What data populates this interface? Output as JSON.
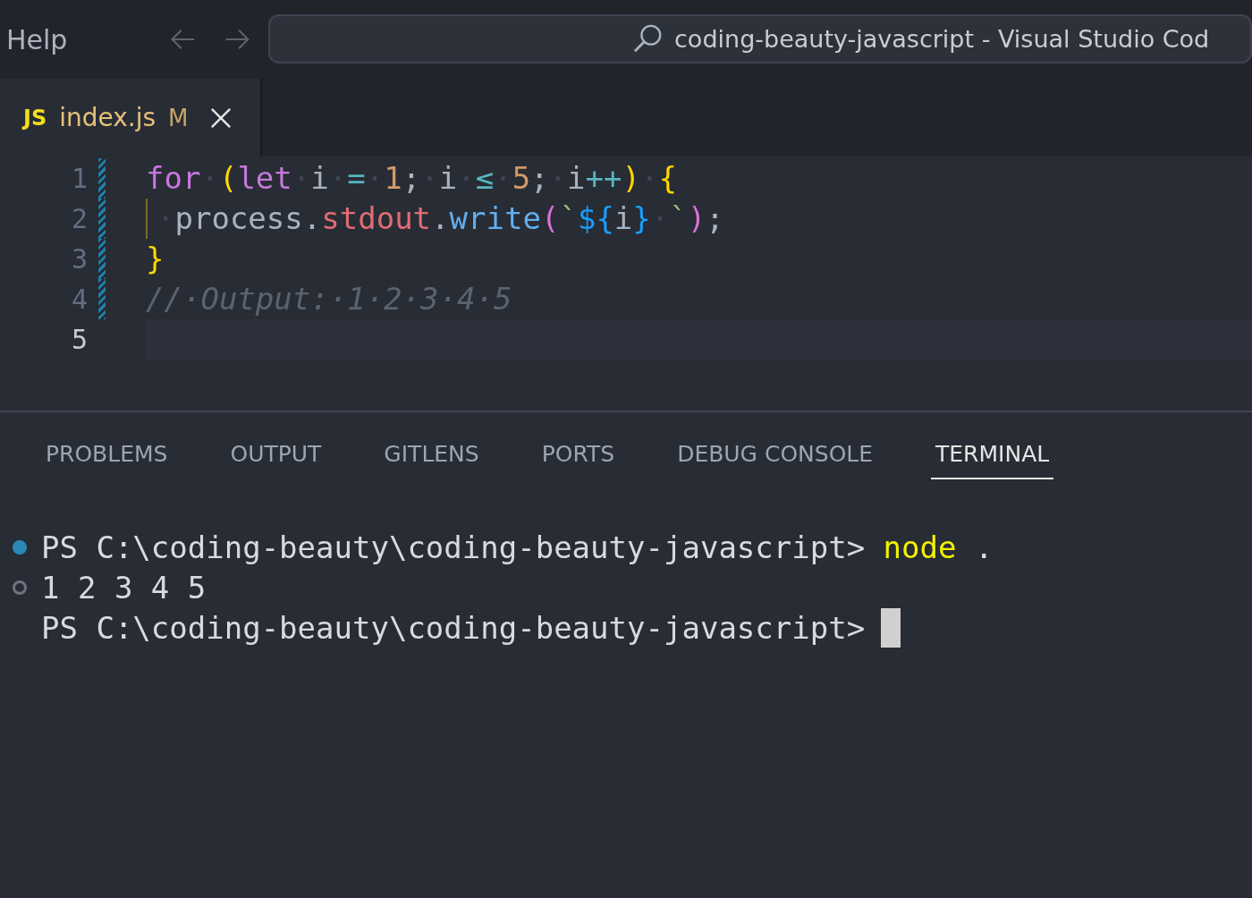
{
  "menu": {
    "label": "Help"
  },
  "command_center": {
    "title": "coding-beauty-javascript - Visual Studio Cod"
  },
  "editor_tabs": [
    {
      "icon_text": "JS",
      "label": "index.js",
      "status": "M",
      "selected": true
    }
  ],
  "editor": {
    "lines": [
      {
        "number": "1",
        "modified": true,
        "current": false,
        "tokens": [
          {
            "kind": "keyword",
            "text": "for"
          },
          {
            "kind": "space",
            "text": "·"
          },
          {
            "kind": "bracket1",
            "text": "("
          },
          {
            "kind": "keyword",
            "text": "let"
          },
          {
            "kind": "space",
            "text": "·"
          },
          {
            "kind": "variable",
            "text": "i"
          },
          {
            "kind": "space",
            "text": "·"
          },
          {
            "kind": "operator",
            "text": "="
          },
          {
            "kind": "space",
            "text": "·"
          },
          {
            "kind": "number",
            "text": "1"
          },
          {
            "kind": "punct",
            "text": ";"
          },
          {
            "kind": "space",
            "text": "·"
          },
          {
            "kind": "variable",
            "text": "i"
          },
          {
            "kind": "space",
            "text": "·"
          },
          {
            "kind": "operator",
            "text": "≤"
          },
          {
            "kind": "space",
            "text": "·"
          },
          {
            "kind": "number",
            "text": "5"
          },
          {
            "kind": "punct",
            "text": ";"
          },
          {
            "kind": "space",
            "text": "·"
          },
          {
            "kind": "variable",
            "text": "i"
          },
          {
            "kind": "operator",
            "text": "++"
          },
          {
            "kind": "bracket1",
            "text": ")"
          },
          {
            "kind": "space",
            "text": "·"
          },
          {
            "kind": "bracket1",
            "text": "{"
          }
        ]
      },
      {
        "number": "2",
        "modified": true,
        "current": false,
        "indent": true,
        "tokens": [
          {
            "kind": "space",
            "text": "·"
          },
          {
            "kind": "variable",
            "text": "process"
          },
          {
            "kind": "punct",
            "text": "."
          },
          {
            "kind": "property",
            "text": "stdout"
          },
          {
            "kind": "punct",
            "text": "."
          },
          {
            "kind": "function",
            "text": "write"
          },
          {
            "kind": "bracket2",
            "text": "("
          },
          {
            "kind": "string",
            "text": "`"
          },
          {
            "kind": "interp",
            "text": "${"
          },
          {
            "kind": "variable",
            "text": "i"
          },
          {
            "kind": "interp",
            "text": "}"
          },
          {
            "kind": "space",
            "text": "·"
          },
          {
            "kind": "string",
            "text": "`"
          },
          {
            "kind": "bracket2",
            "text": ")"
          },
          {
            "kind": "punct",
            "text": ";"
          }
        ]
      },
      {
        "number": "3",
        "modified": true,
        "current": false,
        "tokens": [
          {
            "kind": "bracket1",
            "text": "}"
          }
        ]
      },
      {
        "number": "4",
        "modified": true,
        "current": false,
        "tokens": [
          {
            "kind": "comment",
            "text": "//·Output:·1·2·3·4·5"
          }
        ]
      },
      {
        "number": "5",
        "modified": false,
        "current": true
      }
    ]
  },
  "panel_tabs": [
    {
      "label": "PROBLEMS",
      "selected": false
    },
    {
      "label": "OUTPUT",
      "selected": false
    },
    {
      "label": "GITLENS",
      "selected": false
    },
    {
      "label": "PORTS",
      "selected": false
    },
    {
      "label": "DEBUG CONSOLE",
      "selected": false
    },
    {
      "label": "TERMINAL",
      "selected": true
    }
  ],
  "terminal": {
    "lines": [
      {
        "kind": "success",
        "prompt": "PS C:\\coding-beauty\\coding-beauty-javascript>",
        "command": "node",
        "args": " ."
      },
      {
        "kind": "neutral",
        "output": "1 2 3 4 5"
      },
      {
        "kind": "plain",
        "prompt": "PS C:\\coding-beauty\\coding-beauty-javascript>",
        "cursor": true
      }
    ]
  }
}
